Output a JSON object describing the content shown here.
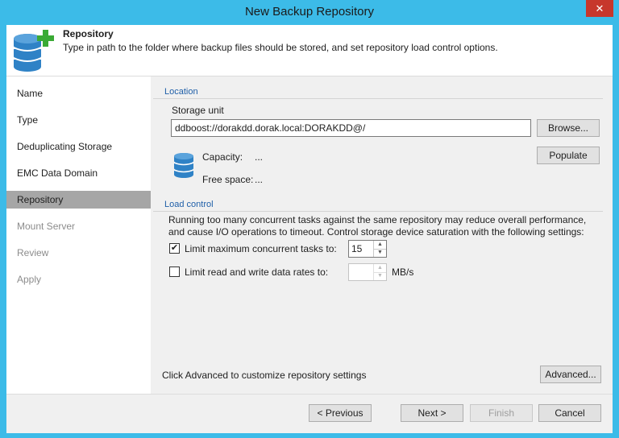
{
  "window": {
    "title": "New Backup Repository",
    "close_glyph": "✕"
  },
  "header": {
    "title": "Repository",
    "description": "Type in path to the folder where backup files should be stored, and set repository load control options.",
    "icon": "database-add-icon"
  },
  "sidebar": {
    "items": [
      {
        "label": "Name",
        "state": "normal"
      },
      {
        "label": "Type",
        "state": "normal"
      },
      {
        "label": "Deduplicating Storage",
        "state": "normal"
      },
      {
        "label": "EMC Data Domain",
        "state": "normal"
      },
      {
        "label": "Repository",
        "state": "active"
      },
      {
        "label": "Mount Server",
        "state": "disabled"
      },
      {
        "label": "Review",
        "state": "disabled"
      },
      {
        "label": "Apply",
        "state": "disabled"
      }
    ]
  },
  "location": {
    "section_label": "Location",
    "storage_unit_label": "Storage unit",
    "storage_unit_value": "ddboost://dorakdd.dorak.local:DORAKDD@/",
    "browse_label": "Browse...",
    "populate_label": "Populate",
    "capacity_label": "Capacity:",
    "capacity_value": "...",
    "free_space_label": "Free space:",
    "free_space_value": "..."
  },
  "load_control": {
    "section_label": "Load control",
    "description_line1": "Running too many concurrent tasks against the same repository may reduce overall performance,",
    "description_line2": "and cause I/O operations to timeout. Control storage device saturation with the following settings:",
    "limit_tasks_label": "Limit maximum concurrent tasks to:",
    "limit_tasks_checked": true,
    "limit_tasks_value": "15",
    "limit_rate_label": "Limit read and write data rates to:",
    "limit_rate_checked": false,
    "limit_rate_value": "",
    "limit_rate_unit": "MB/s",
    "check_glyph": "✔"
  },
  "advanced": {
    "hint": "Click Advanced to customize repository settings",
    "button_label": "Advanced..."
  },
  "footer": {
    "previous_label": "< Previous",
    "next_label": "Next >",
    "finish_label": "Finish",
    "cancel_label": "Cancel"
  },
  "colors": {
    "accent": "#3cbbe8",
    "close": "#c7372c",
    "db_icon": "#2f82c6",
    "plus": "#3aaa35"
  }
}
